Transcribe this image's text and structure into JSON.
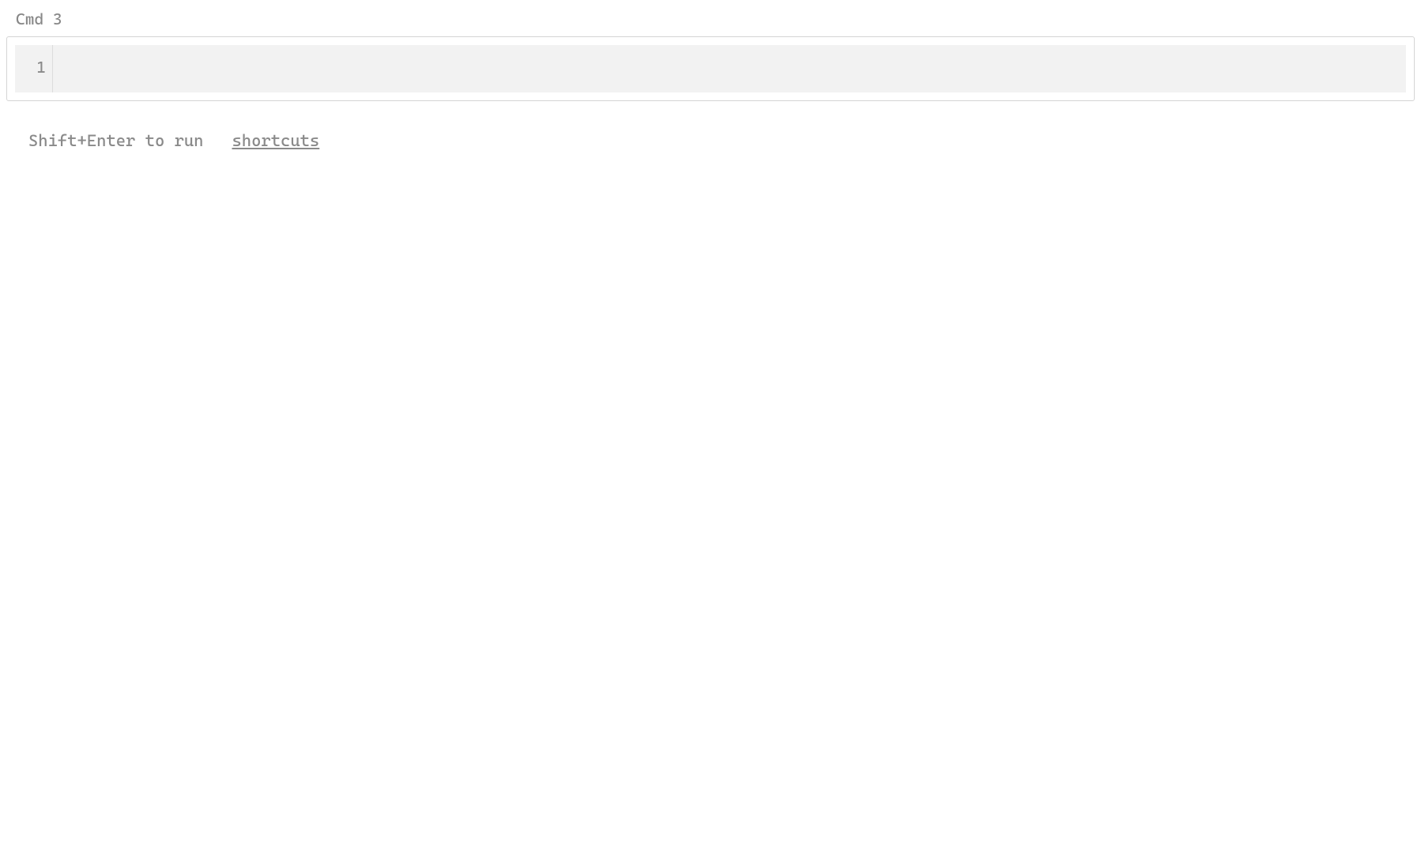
{
  "cell": {
    "label": "Cmd 3",
    "line_number": "1",
    "content": ""
  },
  "hints": {
    "run_hint": "Shift+Enter to run",
    "shortcuts_label": "shortcuts"
  }
}
